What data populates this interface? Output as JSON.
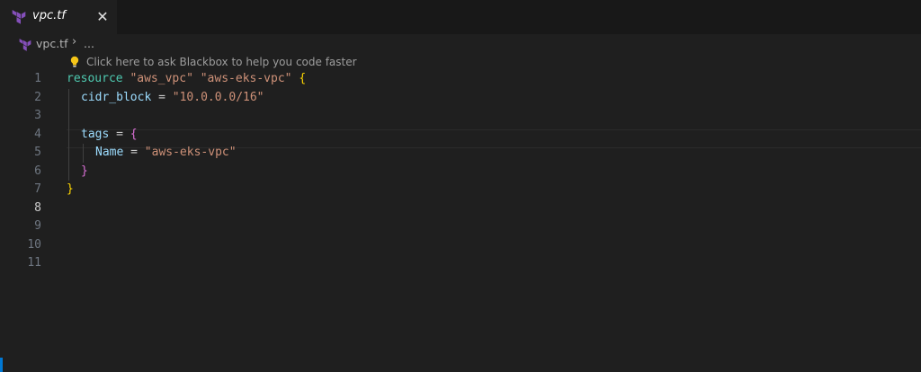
{
  "tab": {
    "label": "vpc.tf",
    "close_glyph": "✕",
    "icon": "terraform-icon"
  },
  "breadcrumb": {
    "file": "vpc.tf",
    "chevron": "›",
    "more": "..."
  },
  "hint": {
    "icon": "lightbulb-icon",
    "text": "Click here to ask Blackbox to help you code faster"
  },
  "editor": {
    "line_numbers": [
      "1",
      "2",
      "3",
      "4",
      "5",
      "6",
      "7",
      "8",
      "9",
      "10",
      "11"
    ],
    "active_line": "8",
    "code": {
      "l1": {
        "kw": "resource",
        "s1": "\"aws_vpc\"",
        "s2": "\"aws-eks-vpc\"",
        "brace": "{"
      },
      "l2": {
        "attr": "cidr_block",
        "op": " = ",
        "str": "\"10.0.0.0/16\""
      },
      "l4": {
        "attr": "tags",
        "op": " = ",
        "brace": "{"
      },
      "l5": {
        "attr": "Name",
        "op": " = ",
        "str": "\"aws-eks-vpc\""
      },
      "l6": {
        "brace": "}"
      },
      "l7": {
        "brace": "}"
      }
    }
  },
  "colors": {
    "background": "#1f1f1f",
    "keyword": "#4ec9b0",
    "string": "#ce9178",
    "attribute": "#9cdcfe",
    "bracket_level1": "#ffd700",
    "bracket_level2": "#da70d6",
    "terraform_purple": "#7b42bc",
    "accent_blue": "#0078d4"
  }
}
